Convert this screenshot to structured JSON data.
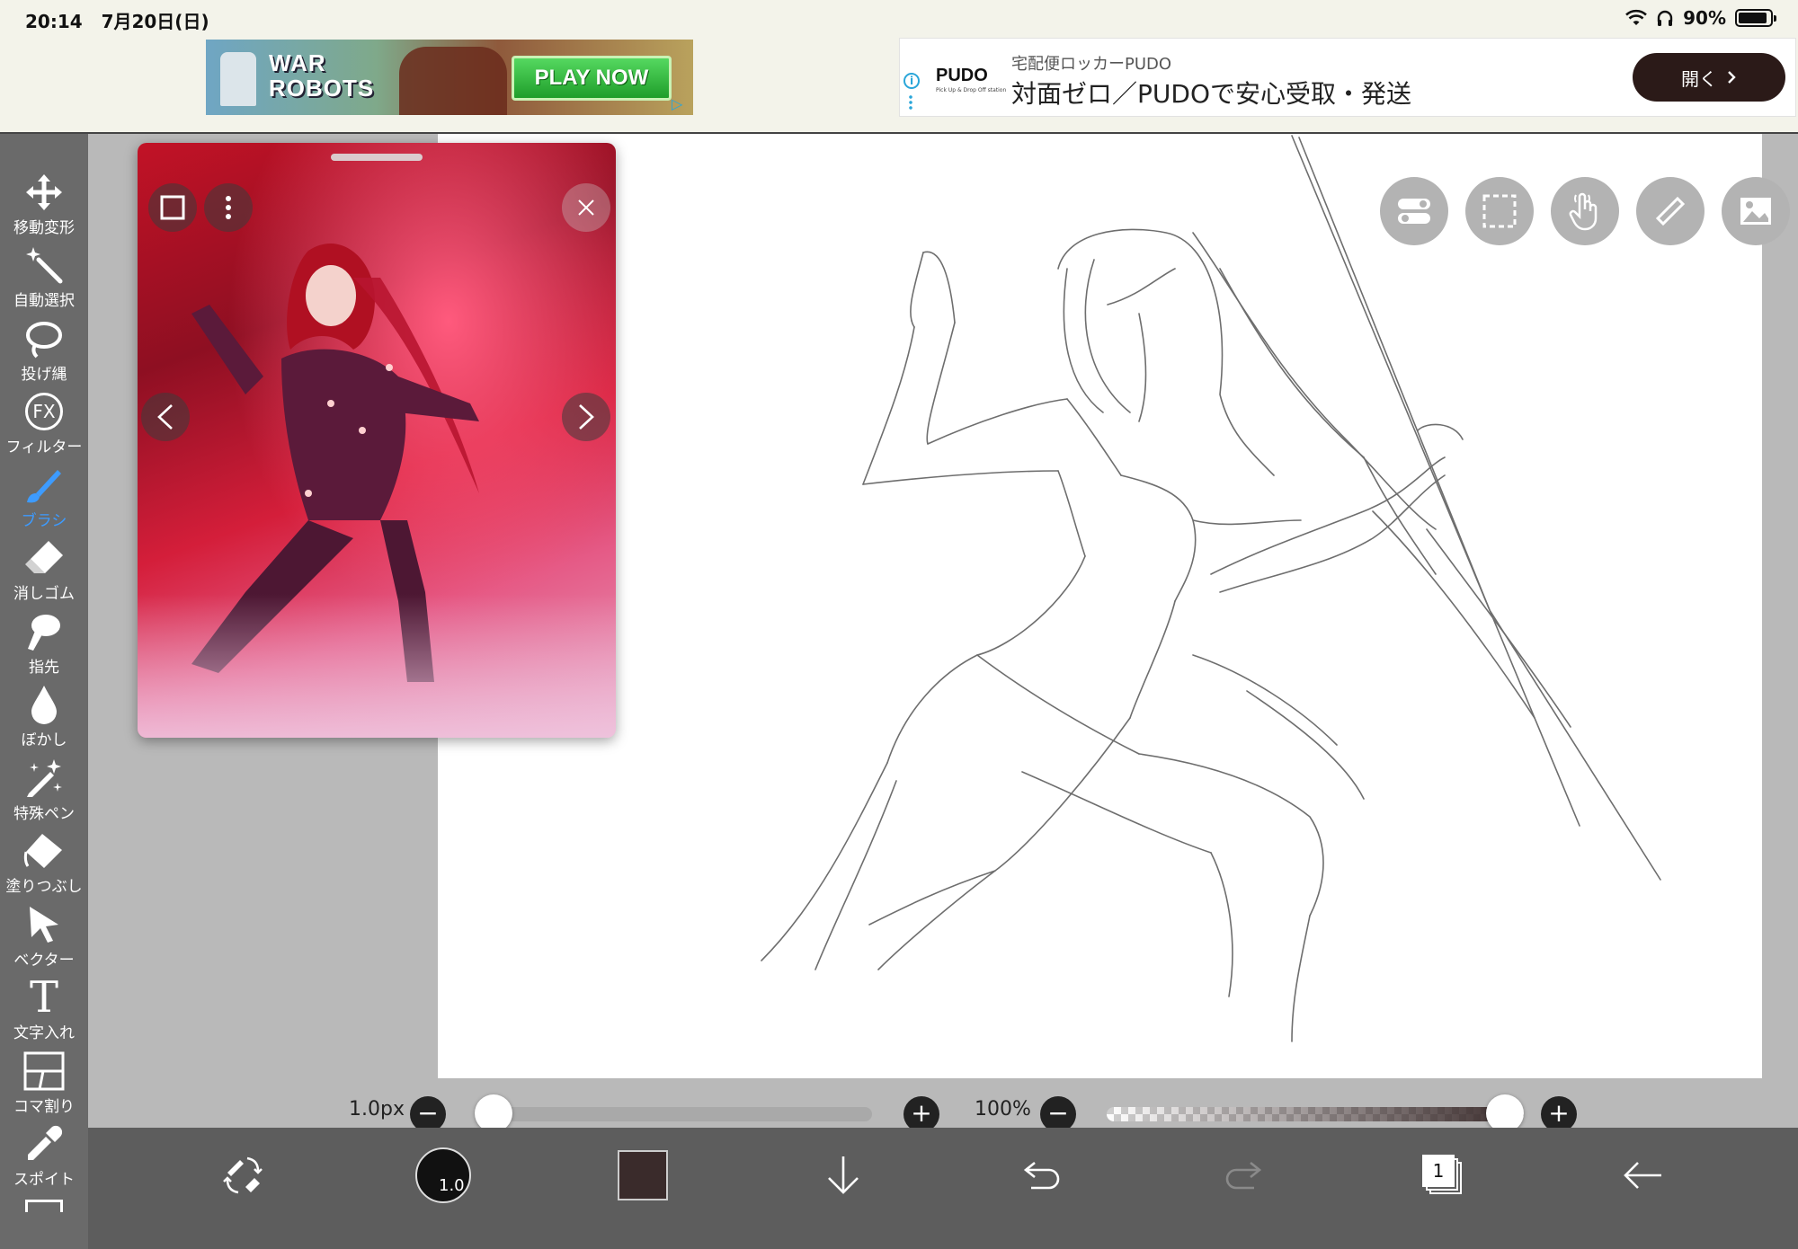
{
  "status": {
    "time": "20:14",
    "date": "7月20日(日)",
    "battery": "90%",
    "battery_level": 0.9
  },
  "ads": {
    "left": {
      "title_line1": "WAR",
      "title_line2": "ROBOTS",
      "cta": "PLAY NOW"
    },
    "right": {
      "brand": "PUDO",
      "brand_sub": "Pick Up & Drop Off station",
      "subtitle": "宅配便ロッカーPUDO",
      "headline": "対面ゼロ／PUDOで安心受取・発送",
      "open_label": "開く"
    }
  },
  "tools": [
    {
      "name": "move",
      "label": "移動変形",
      "icon": "move-icon"
    },
    {
      "name": "magic-wand",
      "label": "自動選択",
      "icon": "magic-wand-icon"
    },
    {
      "name": "lasso",
      "label": "投げ縄",
      "icon": "lasso-icon"
    },
    {
      "name": "filter",
      "label": "フィルター",
      "icon": "fx-icon",
      "icon_text": "FX"
    },
    {
      "name": "brush",
      "label": "ブラシ",
      "icon": "brush-icon",
      "active": true
    },
    {
      "name": "eraser",
      "label": "消しゴム",
      "icon": "eraser-icon"
    },
    {
      "name": "finger",
      "label": "指先",
      "icon": "finger-icon"
    },
    {
      "name": "blur",
      "label": "ぼかし",
      "icon": "droplet-icon"
    },
    {
      "name": "special-pen",
      "label": "特殊ペン",
      "icon": "sparkle-pen-icon"
    },
    {
      "name": "fill",
      "label": "塗りつぶし",
      "icon": "bucket-icon"
    },
    {
      "name": "vector",
      "label": "ベクター",
      "icon": "cursor-icon"
    },
    {
      "name": "text",
      "label": "文字入れ",
      "icon": "text-icon",
      "icon_text": "T"
    },
    {
      "name": "panel",
      "label": "コマ割り",
      "icon": "panel-icon"
    },
    {
      "name": "eyedropper",
      "label": "スポイト",
      "icon": "eyedropper-icon"
    }
  ],
  "sliders": {
    "size_value": "1.0px",
    "size_level": 0.0,
    "opacity_value": "100%",
    "opacity_level": 1.0
  },
  "bottom": {
    "brush_size": "1.0",
    "color": "#3a2b2b",
    "layer_count": "1"
  },
  "colors": {
    "accent": "#3d9bff",
    "toolbar_bg": "#6a6a6a",
    "bottombar_bg": "#5d5d5d"
  }
}
